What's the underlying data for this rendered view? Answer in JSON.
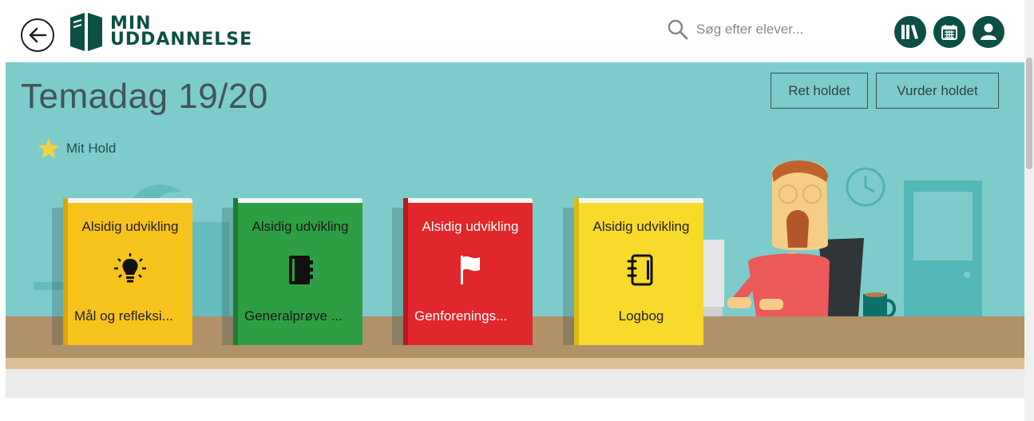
{
  "header": {
    "back_icon": "arrow-left-circle-icon",
    "logo_line1": "MIN",
    "logo_line2": "UDDANNELSE",
    "search": {
      "placeholder": "Søg efter elever...",
      "icon": "search-icon"
    },
    "actions": [
      {
        "icon": "library-icon"
      },
      {
        "icon": "calendar-icon"
      },
      {
        "icon": "user-icon"
      }
    ]
  },
  "hero": {
    "title": "Temadag 19/20",
    "favorite_label": "Mit Hold",
    "edit_button": "Ret holdet",
    "evaluate_button": "Vurder holdet"
  },
  "books": [
    {
      "category": "Alsidig udvikling",
      "name": "Mål og refleksi...",
      "icon": "lightbulb-icon",
      "color": "#f6c21c",
      "spine": "#d8a60c",
      "text_color": "#222222"
    },
    {
      "category": "Alsidig udvikling",
      "name": "Generalprøve ...",
      "icon": "notebook-icon",
      "color": "#2e9e45",
      "spine": "#1f7d33",
      "text_color": "#1a1a1a"
    },
    {
      "category": "Alsidig udvikling",
      "name": "Genforenings...",
      "icon": "flag-icon",
      "color": "#e0272b",
      "spine": "#b51a1d",
      "text_color": "#ffffff"
    },
    {
      "category": "Alsidig udvikling",
      "name": "Logbog",
      "icon": "spiral-notebook-icon",
      "color": "#f8da2b",
      "spine": "#d9bb14",
      "text_color": "#222222"
    }
  ],
  "colors": {
    "brand": "#0c4f45",
    "hero_bg": "#7dcccb",
    "desk": "#b0916a"
  }
}
